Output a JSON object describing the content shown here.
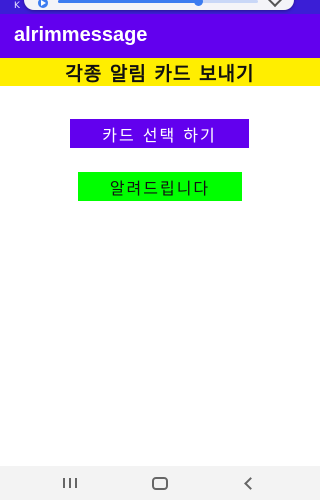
{
  "status_bar": {
    "carrier": "K",
    "right_text": ""
  },
  "media": {
    "progress": 0.7,
    "icons": [
      "play-icon",
      "expand-icon"
    ]
  },
  "app_bar": {
    "title": "alrimmessage",
    "color": "#6200ee"
  },
  "banner": {
    "text": "각종 알림 카드 보내기",
    "color": "#ffee00"
  },
  "buttons": {
    "select_card": "카드 선택 하기",
    "notify": "알려드립니다"
  },
  "colors": {
    "select_button": "#6200ee",
    "notify_button": "#00ff00"
  },
  "nav_bar": {
    "icons": [
      "recents-icon",
      "home-icon",
      "back-icon"
    ]
  }
}
